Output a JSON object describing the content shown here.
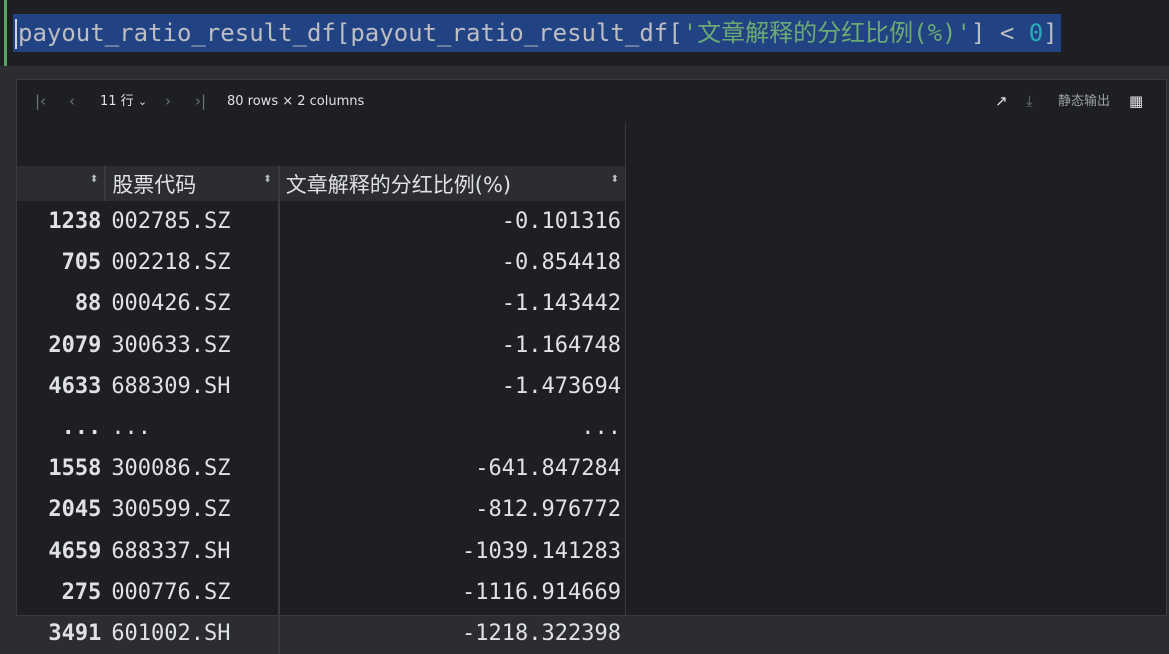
{
  "code": {
    "var1": "payout_ratio_result_df",
    "bracket_open": "[",
    "var2": "payout_ratio_result_df",
    "bracket_open2": "[",
    "column_string": "'文章解释的分红比例(%)'",
    "bracket_close2": "]",
    "operator": " < ",
    "number": "0",
    "bracket_close": "]"
  },
  "toolbar": {
    "row_count_label": "11 行",
    "shape_info": "80 rows × 2 columns",
    "static_output_label": "静态输出"
  },
  "table": {
    "columns": [
      "",
      "股票代码",
      "文章解释的分红比例(%)"
    ],
    "rows": [
      {
        "index": "1238",
        "code": "002785.SZ",
        "value": "-0.101316"
      },
      {
        "index": "705",
        "code": "002218.SZ",
        "value": "-0.854418"
      },
      {
        "index": "88",
        "code": "000426.SZ",
        "value": "-1.143442"
      },
      {
        "index": "2079",
        "code": "300633.SZ",
        "value": "-1.164748"
      },
      {
        "index": "4633",
        "code": "688309.SH",
        "value": "-1.473694"
      },
      {
        "index": "...",
        "code": "...",
        "value": "..."
      },
      {
        "index": "1558",
        "code": "300086.SZ",
        "value": "-641.847284"
      },
      {
        "index": "2045",
        "code": "300599.SZ",
        "value": "-812.976772"
      },
      {
        "index": "4659",
        "code": "688337.SH",
        "value": "-1039.141283"
      },
      {
        "index": "275",
        "code": "000776.SZ",
        "value": "-1116.914669"
      },
      {
        "index": "3491",
        "code": "601002.SH",
        "value": "-1218.322398"
      }
    ]
  }
}
